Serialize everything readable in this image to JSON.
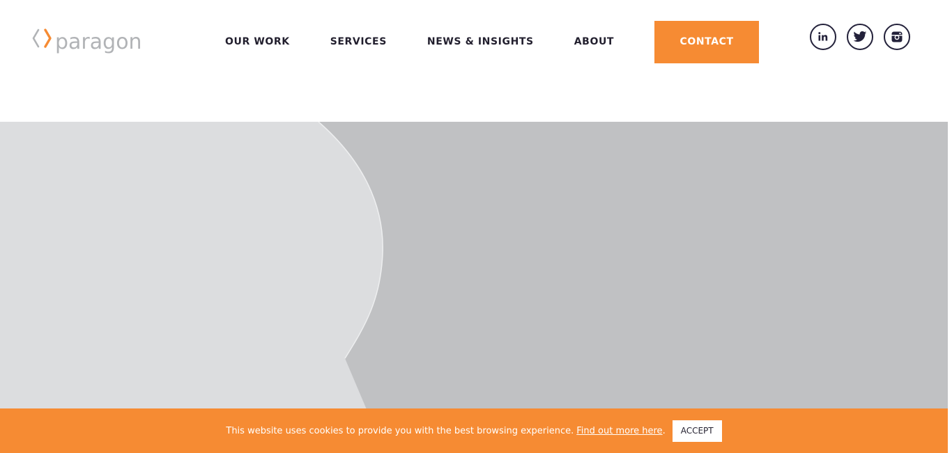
{
  "brand": {
    "name": "paragon",
    "logo_icon": "chevron-brackets-icon",
    "logo_colors": {
      "left_chevron": "#b1b3b6",
      "right_chevron": "#f68b33",
      "text": "#b1b3b6"
    }
  },
  "nav": {
    "items": [
      {
        "label": "OUR WORK"
      },
      {
        "label": "SERVICES"
      },
      {
        "label": "NEWS & INSIGHTS"
      },
      {
        "label": "ABOUT"
      }
    ],
    "contact_label": "CONTACT"
  },
  "social": [
    {
      "icon": "linkedin-icon"
    },
    {
      "icon": "twitter-icon"
    },
    {
      "icon": "instagram-icon"
    }
  ],
  "hero": {
    "background": "#c0c1c3",
    "silhouette": "#dcdddf"
  },
  "cookie_banner": {
    "message": "This website uses cookies to provide you with the best browsing experience.",
    "link_text": "Find out more here",
    "accept_label": "ACCEPT",
    "background": "#f68b33"
  },
  "colors": {
    "accent": "#f68b33",
    "dark": "#221f2e"
  }
}
